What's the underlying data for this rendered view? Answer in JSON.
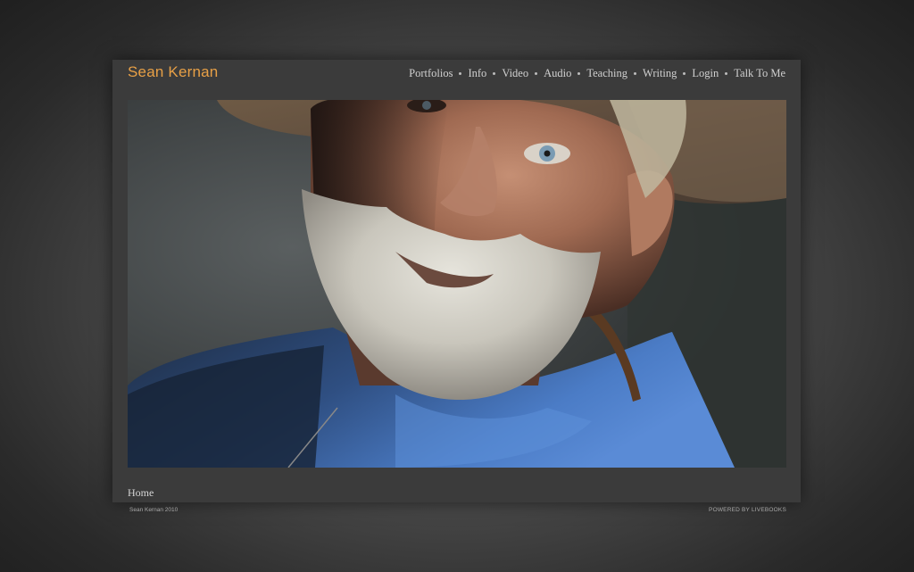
{
  "site": {
    "title": "Sean Kernan"
  },
  "nav": {
    "items": [
      {
        "label": "Portfolios"
      },
      {
        "label": "Info"
      },
      {
        "label": "Video"
      },
      {
        "label": "Audio"
      },
      {
        "label": "Teaching"
      },
      {
        "label": "Writing"
      },
      {
        "label": "Login"
      },
      {
        "label": "Talk To Me"
      }
    ]
  },
  "page": {
    "label": "Home"
  },
  "footer": {
    "copyright": "Sean Kernan 2010",
    "powered_by": "POWERED BY LIVEBOOKS"
  },
  "colors": {
    "accent": "#e8a046",
    "frame": "#3b3b3b",
    "nav_text": "#d0d0d0"
  }
}
